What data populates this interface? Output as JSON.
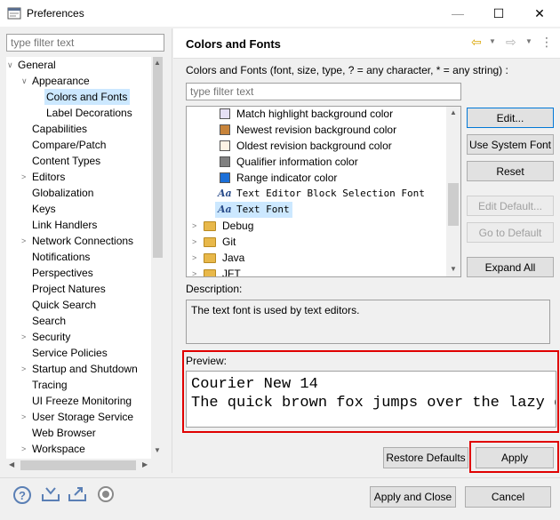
{
  "window": {
    "title": "Preferences",
    "min_glyph": "—",
    "max_glyph": "☐",
    "close_glyph": "✕"
  },
  "left": {
    "filter_placeholder": "type filter text",
    "tree": [
      {
        "label": "General",
        "twisty": "∨"
      },
      {
        "label": "Appearance",
        "twisty": "∨"
      },
      {
        "label": "Colors and Fonts",
        "twisty": "",
        "selected": true
      },
      {
        "label": "Label Decorations",
        "twisty": ""
      },
      {
        "label": "Capabilities",
        "twisty": ""
      },
      {
        "label": "Compare/Patch",
        "twisty": ""
      },
      {
        "label": "Content Types",
        "twisty": ""
      },
      {
        "label": "Editors",
        "twisty": ">"
      },
      {
        "label": "Globalization",
        "twisty": ""
      },
      {
        "label": "Keys",
        "twisty": ""
      },
      {
        "label": "Link Handlers",
        "twisty": ""
      },
      {
        "label": "Network Connections",
        "twisty": ">"
      },
      {
        "label": "Notifications",
        "twisty": ""
      },
      {
        "label": "Perspectives",
        "twisty": ""
      },
      {
        "label": "Project Natures",
        "twisty": ""
      },
      {
        "label": "Quick Search",
        "twisty": ""
      },
      {
        "label": "Search",
        "twisty": ""
      },
      {
        "label": "Security",
        "twisty": ">"
      },
      {
        "label": "Service Policies",
        "twisty": ""
      },
      {
        "label": "Startup and Shutdown",
        "twisty": ">"
      },
      {
        "label": "Tracing",
        "twisty": ""
      },
      {
        "label": "UI Freeze Monitoring",
        "twisty": ""
      },
      {
        "label": "User Storage Service",
        "twisty": ">"
      },
      {
        "label": "Web Browser",
        "twisty": ""
      },
      {
        "label": "Workspace",
        "twisty": ">"
      }
    ]
  },
  "right": {
    "title": "Colors and Fonts",
    "description_label": "Colors and Fonts (font, size, type, ? = any character, * = any string) :",
    "filter_placeholder": "type filter text",
    "items": [
      {
        "label": "Match highlight background color",
        "kind": "color",
        "color": "#e6e0f5"
      },
      {
        "label": "Newest revision background color",
        "kind": "color",
        "color": "#c8843a"
      },
      {
        "label": "Oldest revision background color",
        "kind": "color",
        "color": "#fdf3e4"
      },
      {
        "label": "Qualifier information color",
        "kind": "color",
        "color": "#808080"
      },
      {
        "label": "Range indicator color",
        "kind": "color",
        "color": "#1b6fd8"
      },
      {
        "label": "Text Editor Block Selection Font",
        "kind": "font"
      },
      {
        "label": "Text Font",
        "kind": "font",
        "selected": true
      },
      {
        "label": "Debug",
        "kind": "folder"
      },
      {
        "label": "Git",
        "kind": "folder"
      },
      {
        "label": "Java",
        "kind": "folder"
      },
      {
        "label": "JFT",
        "kind": "folder"
      }
    ],
    "font_icon_glyph": "Aa",
    "buttons": {
      "edit": "Edit...",
      "use_system_font": "Use System Font",
      "reset": "Reset",
      "edit_default": "Edit Default...",
      "go_to_default": "Go to Default",
      "expand_all": "Expand All"
    },
    "description_caption": "Description:",
    "description_text": "The text font is used by text editors.",
    "preview_caption": "Preview:",
    "preview_lines": [
      "Courier New 14",
      "The quick brown fox jumps over the lazy dog."
    ],
    "restore_defaults": "Restore Defaults",
    "apply": "Apply"
  },
  "footer": {
    "apply_and_close": "Apply and Close",
    "cancel": "Cancel",
    "help_glyph": "?"
  },
  "colors": {
    "selection": "#cce8ff",
    "highlight_red": "#e00000",
    "focus_blue": "#0078d7"
  }
}
